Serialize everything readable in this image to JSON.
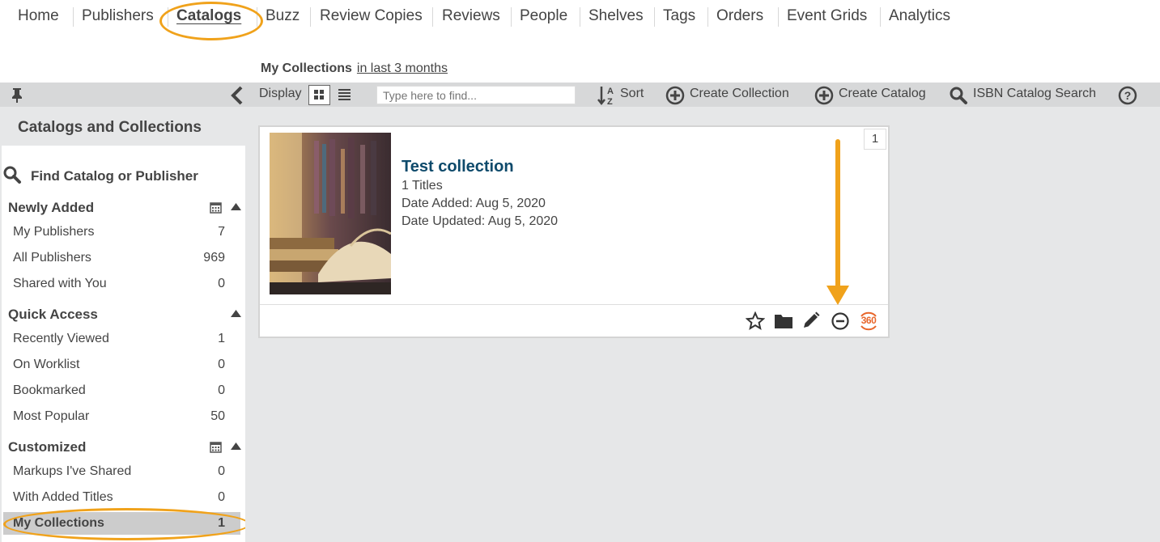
{
  "nav": {
    "items": [
      "Home",
      "Publishers",
      "Catalogs",
      "Buzz",
      "Review Copies",
      "Reviews",
      "People",
      "Shelves",
      "Tags",
      "Orders",
      "Event Grids",
      "Analytics"
    ],
    "active": "Catalogs"
  },
  "breadcrumb": {
    "title": "My Collections",
    "filter": "in last 3 months"
  },
  "toolbar": {
    "display_label": "Display",
    "search_placeholder": "Type here to find...",
    "sort_label": "Sort",
    "create_collection": "Create Collection",
    "create_catalog": "Create Catalog",
    "isbn_search": "ISBN Catalog Search"
  },
  "sidebar": {
    "title": "Catalogs and Collections",
    "find_label": "Find Catalog or Publisher",
    "sections": [
      {
        "title": "Newly Added",
        "items": [
          {
            "label": "My Publishers",
            "count": "7"
          },
          {
            "label": "All Publishers",
            "count": "969"
          },
          {
            "label": "Shared with You",
            "count": "0"
          }
        ]
      },
      {
        "title": "Quick Access",
        "items": [
          {
            "label": "Recently Viewed",
            "count": "1"
          },
          {
            "label": "On Worklist",
            "count": "0"
          },
          {
            "label": "Bookmarked",
            "count": "0"
          },
          {
            "label": "Most Popular",
            "count": "50"
          }
        ]
      },
      {
        "title": "Customized",
        "items": [
          {
            "label": "Markups I've Shared",
            "count": "0"
          },
          {
            "label": "With Added Titles",
            "count": "0"
          },
          {
            "label": "My Collections",
            "count": "1"
          }
        ]
      }
    ]
  },
  "card": {
    "index": "1",
    "title": "Test collection",
    "titles": "1 Titles",
    "date_added": "Date Added: Aug 5, 2020",
    "date_updated": "Date Updated: Aug 5, 2020",
    "badge_360": "360"
  },
  "colors": {
    "highlight": "#f0a21b",
    "title": "#0e4a6b",
    "toolbar": "#d7d8d9",
    "background": "#e6e7e8"
  }
}
